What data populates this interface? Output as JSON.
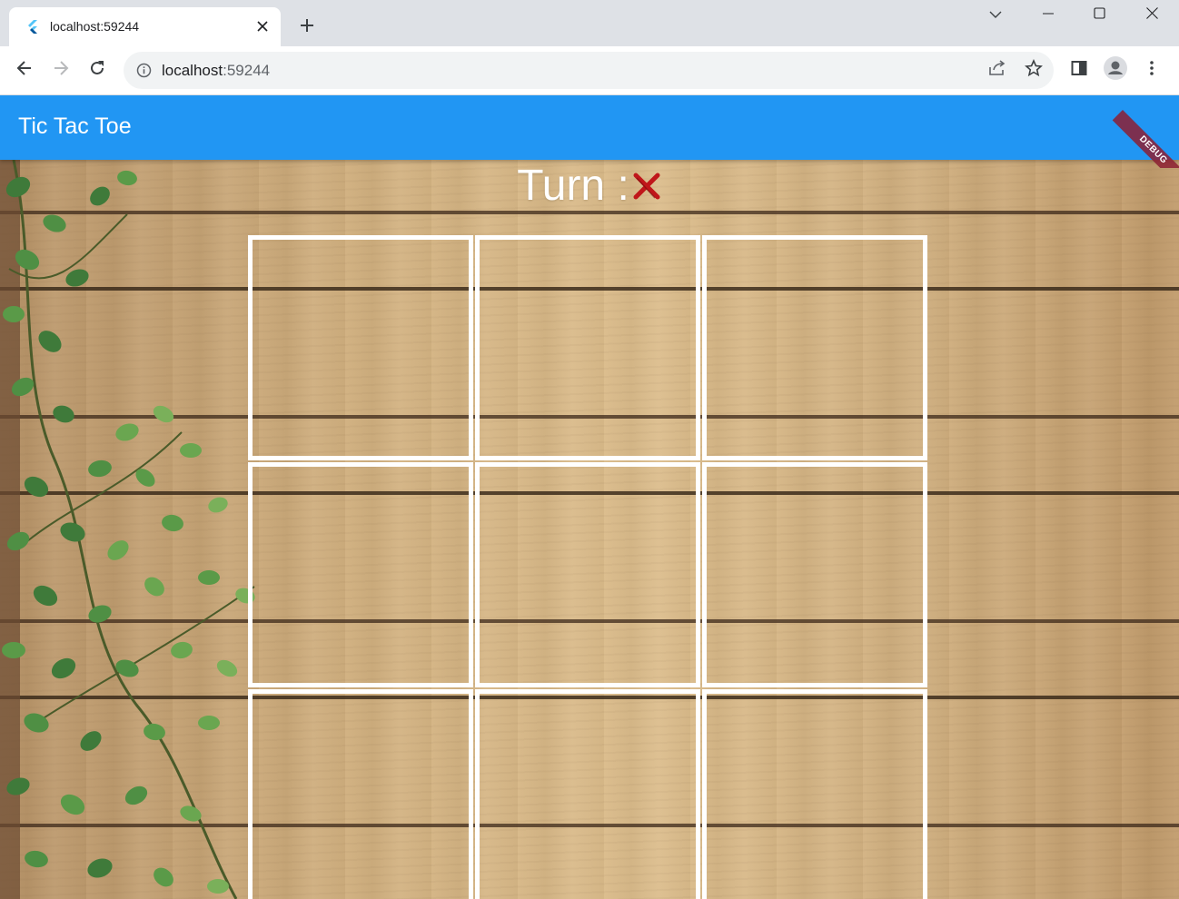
{
  "browser": {
    "tab": {
      "title": "localhost:59244",
      "favicon": "flutter-logo-icon",
      "close_icon": "close-icon"
    },
    "new_tab_icon": "plus-icon",
    "window_controls": [
      "chevron-down-icon",
      "minimize-icon",
      "maximize-icon",
      "close-icon"
    ],
    "toolbar": {
      "back_icon": "arrow-left-icon",
      "forward_icon": "arrow-right-icon",
      "reload_icon": "reload-icon",
      "address": {
        "host": "localhost",
        "port": ":59244",
        "info_icon": "info-icon"
      },
      "share_icon": "share-icon",
      "bookmark_icon": "star-icon",
      "side_panel_icon": "side-panel-icon",
      "profile_icon": "profile-icon",
      "menu_icon": "kebab-menu-icon"
    }
  },
  "app": {
    "title": "Tic Tac Toe",
    "bar_color": "#2196f3",
    "debug_banner": "DEBUG",
    "turn": {
      "label": "Turn :",
      "player_mark": "x-mark-icon",
      "player_color": "#c0161a"
    },
    "board": {
      "cells": [
        "",
        "",
        "",
        "",
        "",
        "",
        "",
        "",
        ""
      ]
    }
  }
}
